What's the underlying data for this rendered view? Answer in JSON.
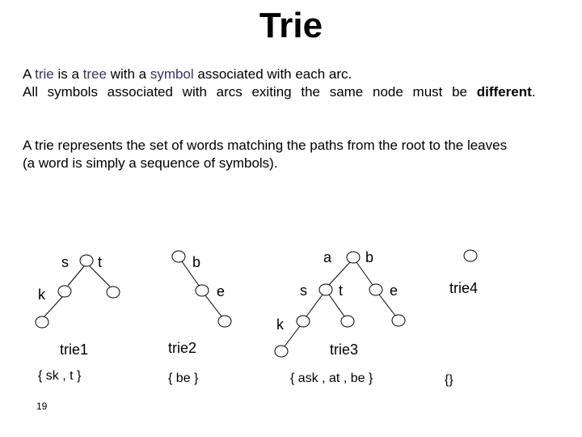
{
  "slide": {
    "title": "Trie",
    "paragraph1": {
      "line1": [
        {
          "text": "A ",
          "style": "normal"
        },
        {
          "text": "trie",
          "style": "highlight"
        },
        {
          "text": " is a ",
          "style": "normal"
        },
        {
          "text": "tree",
          "style": "highlight"
        },
        {
          "text": " with a ",
          "style": "normal"
        },
        {
          "text": "symbol",
          "style": "highlight"
        },
        {
          "text": " associated with each arc.",
          "style": "normal"
        }
      ],
      "line2_prefix": "All symbols associated with arcs exiting the same node must be ",
      "line2_bold": "different",
      "line2_suffix": "."
    },
    "paragraph2": {
      "line1": "A trie represents the set of words matching the paths from the root to the leaves",
      "line2": "(a word is simply a sequence of symbols)."
    },
    "highlight_color": "#333366",
    "page_number": "19"
  },
  "tries": [
    {
      "name": "trie1",
      "words": "{ sk , t }",
      "arc_labels": [
        "s",
        "t",
        "k"
      ]
    },
    {
      "name": "trie2",
      "words": "{ be }",
      "arc_labels": [
        "b",
        "e"
      ]
    },
    {
      "name": "trie3",
      "words": "{ ask , at , be }",
      "arc_labels": [
        "a",
        "b",
        "s",
        "t",
        "e",
        "k"
      ]
    },
    {
      "name": "trie4",
      "words": "{}",
      "arc_labels": []
    }
  ]
}
